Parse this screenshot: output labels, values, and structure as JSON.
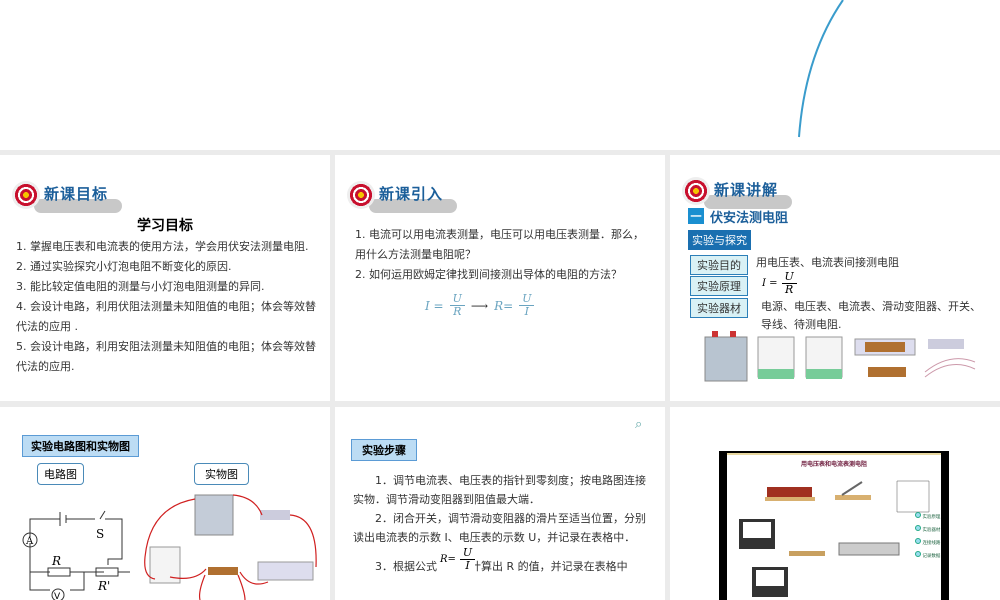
{
  "slide1": {
    "header": "新课目标",
    "title": "学习目标",
    "items": [
      "1. 掌握电压表和电流表的使用方法，学会用伏安法测量电阻.",
      "2. 通过实验探究小灯泡电阻不断变化的原因.",
      "3. 能比较定值电阻的测量与小灯泡电阻测量的异同.",
      "4. 会设计电路，利用伏阻法测量未知阻值的电阻；体会等效替代法的应用 .",
      "5. 会设计电路，利用安阻法测量未知阻值的电阻；体会等效替代法的应用."
    ]
  },
  "slide2": {
    "header": "新课引入",
    "items": [
      "1. 电流可以用电流表测量，电压可以用电压表测量．那么，用什么方法测量电阻呢？",
      "2. 如何运用欧姆定律找到间接测出导体的电阻的方法？"
    ],
    "f1": "I =",
    "f2": "R=",
    "U": "U",
    "R": "R",
    "I": "I"
  },
  "slide3": {
    "header": "新课讲解",
    "section_num": "一",
    "section": "伏安法测电阻",
    "tag": "实验与探究",
    "rows": [
      {
        "label": "实验目的",
        "text": "用电压表、电流表间接测电阻"
      },
      {
        "label": "实验原理",
        "text": "I ="
      },
      {
        "label": "实验器材",
        "text": "电源、电压表、电流表、滑动变阻器、开关、导线、待测电阻."
      }
    ]
  },
  "slide4": {
    "tag": "实验电路图和实物图",
    "circuit": "电路图",
    "physical": "实物图",
    "S": "S",
    "R": "R",
    "Rp": "R'",
    "A": "A",
    "V": "V"
  },
  "slide5": {
    "tag": "实验步骤",
    "steps": [
      "1．调节电流表、电压表的指针到零刻度；按电路图连接实物．调节滑动变阻器到阻值最大端．",
      "2．闭合开关，调节滑动变阻器的滑片至适当位置，分别读出电流表的示数 I、电压表的示数 U，并记录在表格中．",
      "3．根据公式　　　计算出 R 的值，并记录在表格中"
    ],
    "formula": "R="
  },
  "slide6": {
    "title": "用电压表和电流表测电阻",
    "buttons": [
      "实验原理",
      "实验器材",
      "连接线路",
      "记录数据"
    ]
  },
  "colors": {
    "accent": "#1c5f9a",
    "label_bg": "#d9f1f5",
    "wire": "#d02020"
  }
}
